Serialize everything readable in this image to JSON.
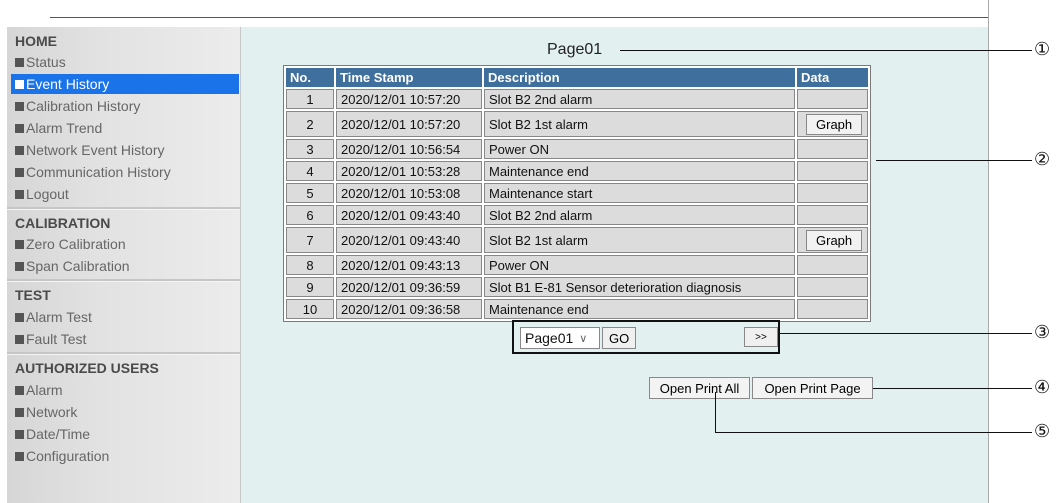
{
  "sidebar": {
    "sections": [
      {
        "title": "HOME",
        "items": [
          "Status",
          "Event History",
          "Calibration History",
          "Alarm Trend",
          "Network Event History",
          "Communication History",
          "Logout"
        ]
      },
      {
        "title": "CALIBRATION",
        "items": [
          "Zero Calibration",
          "Span Calibration"
        ]
      },
      {
        "title": "TEST",
        "items": [
          "Alarm Test",
          "Fault Test"
        ]
      },
      {
        "title": "AUTHORIZED USERS",
        "items": [
          "Alarm",
          "Network",
          "Date/Time",
          "Configuration"
        ]
      }
    ],
    "active_item": "Event History"
  },
  "main": {
    "page_title": "Page01",
    "table": {
      "headers": [
        "No.",
        "Time Stamp",
        "Description",
        "Data"
      ],
      "rows": [
        {
          "no": "1",
          "time": "2020/12/01 10:57:20",
          "desc": "Slot B2 2nd alarm",
          "data": ""
        },
        {
          "no": "2",
          "time": "2020/12/01 10:57:20",
          "desc": "Slot B2 1st alarm",
          "data": "Graph"
        },
        {
          "no": "3",
          "time": "2020/12/01 10:56:54",
          "desc": "Power ON",
          "data": ""
        },
        {
          "no": "4",
          "time": "2020/12/01 10:53:28",
          "desc": "Maintenance end",
          "data": ""
        },
        {
          "no": "5",
          "time": "2020/12/01 10:53:08",
          "desc": "Maintenance start",
          "data": ""
        },
        {
          "no": "6",
          "time": "2020/12/01 09:43:40",
          "desc": "Slot B2 2nd alarm",
          "data": ""
        },
        {
          "no": "7",
          "time": "2020/12/01 09:43:40",
          "desc": "Slot B2 1st alarm",
          "data": "Graph"
        },
        {
          "no": "8",
          "time": "2020/12/01 09:43:13",
          "desc": "Power ON",
          "data": ""
        },
        {
          "no": "9",
          "time": "2020/12/01 09:36:59",
          "desc": "Slot B1 E-81 Sensor deterioration diagnosis",
          "data": ""
        },
        {
          "no": "10",
          "time": "2020/12/01 09:36:58",
          "desc": "Maintenance end",
          "data": ""
        }
      ]
    },
    "pager": {
      "selected_page": "Page01",
      "go_label": "GO",
      "next_label": ">>"
    },
    "print": {
      "all_label": "Open Print All",
      "page_label": "Open Print Page"
    }
  },
  "callouts": [
    "①",
    "②",
    "③",
    "④",
    "⑤"
  ],
  "colors": {
    "active_nav": "#1a73e8",
    "table_header": "#3f6f9c",
    "main_bg": "#e2f0f0"
  }
}
